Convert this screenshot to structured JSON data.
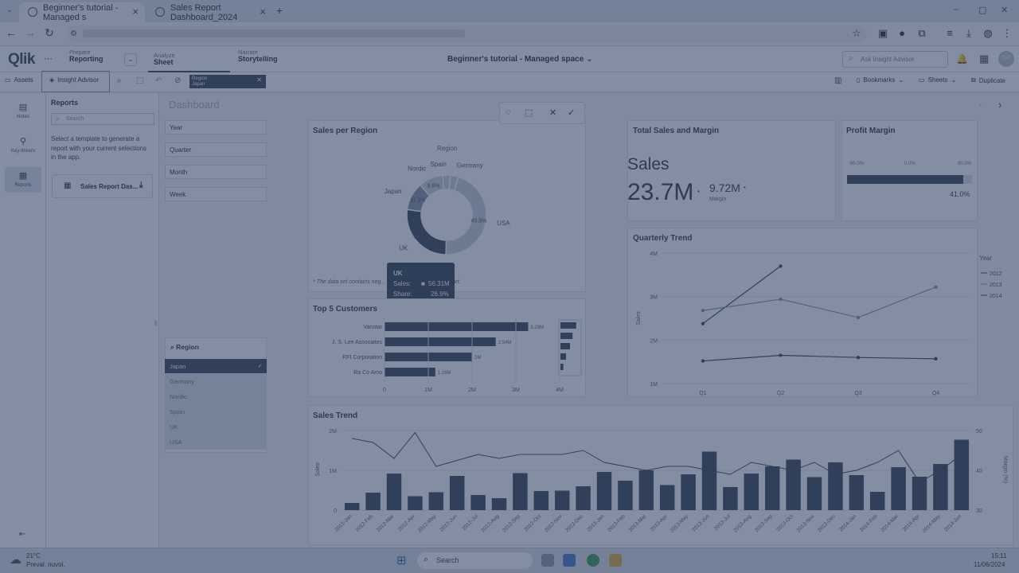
{
  "browser": {
    "tabs": [
      {
        "label": "Beginner's tutorial - Managed s",
        "active": true
      },
      {
        "label": "Sales Report Dashboard_2024",
        "active": false
      }
    ],
    "new_tab": "+",
    "win_controls": [
      "–",
      "▢",
      "✕"
    ]
  },
  "qlik": {
    "logo": "Qlik",
    "nav": [
      {
        "small": "Prepare",
        "big": "Reporting"
      },
      {
        "small": "Analyze",
        "big": "Sheet"
      },
      {
        "small": "Narrate",
        "big": "Storytelling"
      }
    ],
    "app_title": "Beginner's tutorial - Managed space",
    "ask_placeholder": "Ask Insight Advisor",
    "avatar": "GP"
  },
  "toolbar": {
    "assets": "Assets",
    "insight": "Insight Advisor",
    "selection": {
      "field": "Region",
      "value": "Japan"
    },
    "bookmarks": "Bookmarks",
    "sheets": "Sheets",
    "duplicate": "Duplicate"
  },
  "rail": [
    {
      "label": "Notes",
      "icon": "notes-icon"
    },
    {
      "label": "Key drivers",
      "icon": "key-drivers-icon"
    },
    {
      "label": "Reports",
      "icon": "reports-icon"
    }
  ],
  "panel": {
    "title": "Reports",
    "search_placeholder": "Search",
    "description": "Select a template to generate a report with your current selections in the app.",
    "item": "Sales Report Das..."
  },
  "dashboard": {
    "title": "Dashboard",
    "filters": [
      "Year",
      "Quarter",
      "Month",
      "Week"
    ],
    "region_box": {
      "title": "Region",
      "items": [
        {
          "label": "Japan",
          "state": "selected"
        },
        {
          "label": "Germany",
          "state": "excluded"
        },
        {
          "label": "Nordic",
          "state": "excluded"
        },
        {
          "label": "Spain",
          "state": "excluded"
        },
        {
          "label": "UK",
          "state": "excluded"
        },
        {
          "label": "USA",
          "state": "excluded"
        }
      ]
    }
  },
  "tooltip": {
    "title": "UK",
    "sales_label": "Sales:",
    "sales": "56.31M",
    "share_label": "Share:",
    "share": "26.9%"
  },
  "kpi": {
    "title": "Total Sales and Margin",
    "label": "Sales",
    "value": "23.7M",
    "secondary": "9.72M",
    "secondary_label": "Margin"
  },
  "profit": {
    "title": "Profit Margin",
    "scale": [
      "-90.0%",
      "0.0%",
      "90.0%"
    ],
    "value": "41.0%",
    "fraction": 0.93
  },
  "chart_data": [
    {
      "type": "pie",
      "title": "Sales per Region",
      "legend_title": "Region",
      "categories": [
        "USA",
        "UK",
        "Japan",
        "Nordic",
        "Spain",
        "Germany"
      ],
      "values": [
        45.5,
        26.9,
        11.3,
        9.9,
        3.2,
        3.2
      ],
      "labels": [
        "45.5%",
        "26.9%",
        "11.3%",
        "9.9%",
        "",
        ""
      ],
      "footnote": "* The data set contains neg... cannot be shown in this chart."
    },
    {
      "type": "bar",
      "title": "Top 5 Customers",
      "orientation": "horizontal",
      "categories": [
        "Vanstar",
        "J. S. Lee Associates",
        "RFI Corporation",
        "Ra Co Amo"
      ],
      "values": [
        3.28,
        2.54,
        2.0,
        1.16
      ],
      "labels": [
        "3.28M",
        "2.54M",
        "2M",
        "1.16M"
      ],
      "xticks": [
        "0",
        "1M",
        "2M",
        "3M",
        "4M"
      ],
      "xlim": [
        0,
        4
      ]
    },
    {
      "type": "line",
      "title": "Quarterly Trend",
      "ylabel": "Sales",
      "legend_title": "Year",
      "categories": [
        "Q1",
        "Q2",
        "Q3",
        "Q4"
      ],
      "yticks": [
        "1M",
        "2M",
        "3M",
        "4M"
      ],
      "ylim": [
        1,
        4
      ],
      "series": [
        {
          "name": "2012",
          "values": [
            2.38,
            3.7,
            null,
            null
          ]
        },
        {
          "name": "2013",
          "values": [
            2.68,
            2.94,
            2.52,
            3.22
          ]
        },
        {
          "name": "2014",
          "values": [
            1.52,
            1.65,
            1.6,
            1.57
          ]
        }
      ]
    },
    {
      "type": "bar",
      "title": "Sales Trend",
      "ylabel": "Sales",
      "y2label": "Margin (%)",
      "yticks": [
        "0",
        "1M",
        "2M"
      ],
      "y2ticks": [
        "30",
        "40",
        "50"
      ],
      "ylim": [
        0,
        2
      ],
      "y2lim": [
        30,
        50
      ],
      "categories": [
        "2012-Jan",
        "2012-Feb",
        "2012-Mar",
        "2012-Apr",
        "2012-May",
        "2012-Jun",
        "2012-Jul",
        "2012-Aug",
        "2012-Sep",
        "2012-Oct",
        "2012-Nov",
        "2012-Dec",
        "2013-Jan",
        "2013-Feb",
        "2013-Mar",
        "2013-Apr",
        "2013-May",
        "2013-Jun",
        "2013-Jul",
        "2013-Aug",
        "2013-Sep",
        "2013-Oct",
        "2013-Nov",
        "2013-Dec",
        "2014-Jan",
        "2014-Feb",
        "2014-Mar",
        "2014-Apr",
        "2014-May",
        "2014-Jun"
      ],
      "values": [
        0.18,
        0.44,
        0.92,
        0.35,
        0.45,
        0.86,
        0.38,
        0.3,
        0.93,
        0.48,
        0.49,
        0.6,
        0.96,
        0.74,
        1.0,
        0.63,
        0.9,
        1.47,
        0.58,
        0.92,
        1.1,
        1.27,
        0.83,
        1.2,
        0.88,
        0.46,
        1.08,
        0.84,
        1.16,
        1.77
      ],
      "margin": [
        48,
        47,
        43,
        49.5,
        41,
        42.5,
        44,
        43,
        44,
        44,
        44,
        45,
        42,
        41,
        40,
        41,
        41,
        40,
        39,
        42,
        41,
        40,
        42,
        39,
        40,
        42,
        45,
        37,
        40,
        44
      ]
    }
  ],
  "taskbar": {
    "weather_temp": "21°C",
    "weather_desc": "Preval. nuvol.",
    "search": "Search",
    "time": "15:11",
    "date": "11/06/2024"
  }
}
